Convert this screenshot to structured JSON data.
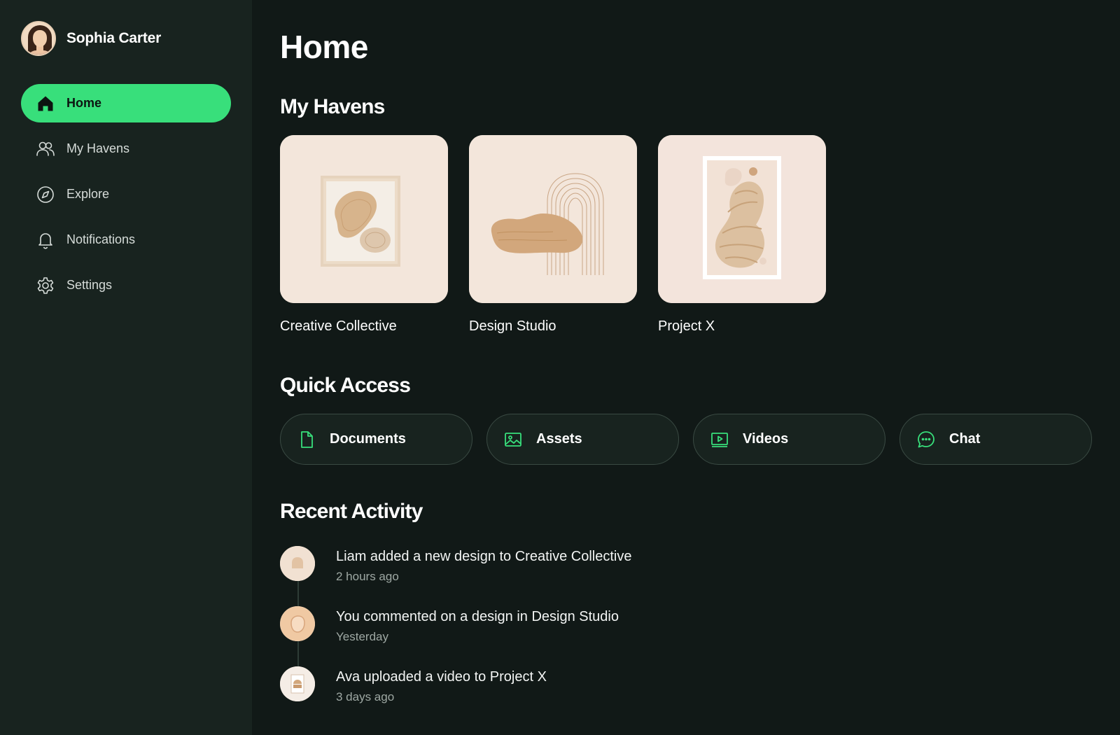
{
  "user": {
    "name": "Sophia Carter"
  },
  "sidebar": {
    "items": [
      {
        "label": "Home",
        "icon": "home-icon",
        "active": true
      },
      {
        "label": "My Havens",
        "icon": "users-icon",
        "active": false
      },
      {
        "label": "Explore",
        "icon": "compass-icon",
        "active": false
      },
      {
        "label": "Notifications",
        "icon": "bell-icon",
        "active": false
      },
      {
        "label": "Settings",
        "icon": "gear-icon",
        "active": false
      }
    ]
  },
  "main": {
    "title": "Home",
    "havens": {
      "title": "My Havens",
      "items": [
        {
          "label": "Creative Collective"
        },
        {
          "label": "Design Studio"
        },
        {
          "label": "Project X"
        }
      ]
    },
    "quick_access": {
      "title": "Quick Access",
      "items": [
        {
          "label": "Documents",
          "icon": "document-icon"
        },
        {
          "label": "Assets",
          "icon": "image-icon"
        },
        {
          "label": "Videos",
          "icon": "video-icon"
        },
        {
          "label": "Chat",
          "icon": "chat-icon"
        }
      ]
    },
    "recent_activity": {
      "title": "Recent Activity",
      "items": [
        {
          "text": "Liam added a new design to Creative Collective",
          "time": "2 hours ago"
        },
        {
          "text": "You commented on a design in Design Studio",
          "time": "Yesterday"
        },
        {
          "text": "Ava uploaded a video to Project X",
          "time": "3 days ago"
        }
      ]
    }
  },
  "colors": {
    "accent": "#38df7b",
    "background": "#111917",
    "sidebar": "#18231f",
    "card": "#f2e6dc"
  }
}
